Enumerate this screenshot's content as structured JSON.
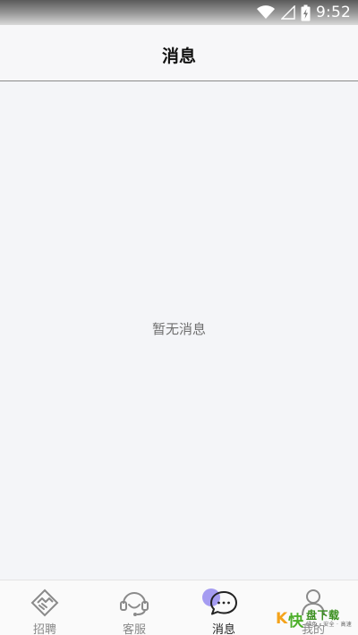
{
  "status_bar": {
    "time": "9:52",
    "icons": [
      "wifi-icon",
      "cellular-signal-icon",
      "battery-charging-icon"
    ]
  },
  "header": {
    "title": "消息"
  },
  "main": {
    "empty_text": "暂无消息"
  },
  "tabbar": {
    "active_index": 2,
    "accent_color": "#9b91ef",
    "items": [
      {
        "label": "招聘",
        "icon": "handshake-icon"
      },
      {
        "label": "客服",
        "icon": "headset-icon"
      },
      {
        "label": "消息",
        "icon": "chat-bubble-icon"
      },
      {
        "label": "我的",
        "icon": "person-icon"
      }
    ]
  },
  "watermark": {
    "k": "K",
    "kuai": "快",
    "title": "盘下载",
    "sub": "绿色 · 安全 · 高速"
  }
}
